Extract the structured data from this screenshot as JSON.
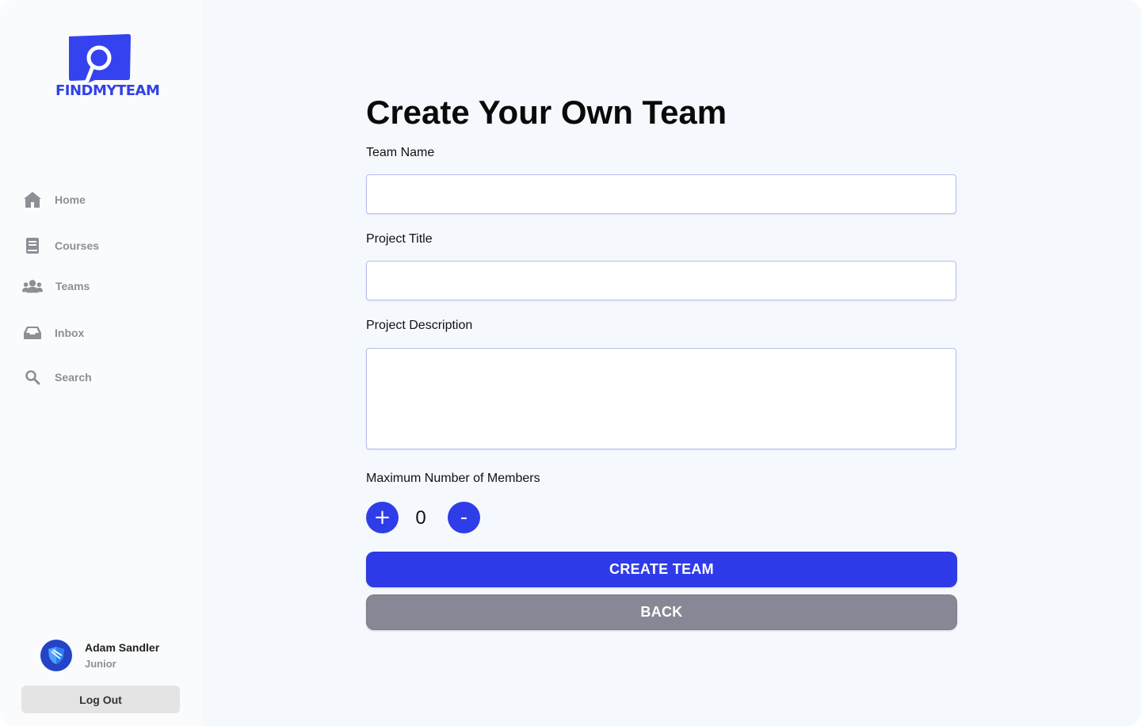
{
  "brand": {
    "name": "FINDMYTEAM",
    "color": "#3240e6"
  },
  "sidebar": {
    "items": [
      {
        "label": "Home",
        "icon": "home-icon"
      },
      {
        "label": "Courses",
        "icon": "book-icon"
      },
      {
        "label": "Teams",
        "icon": "users-icon"
      },
      {
        "label": "Inbox",
        "icon": "inbox-icon"
      },
      {
        "label": "Search",
        "icon": "search-icon"
      }
    ],
    "user": {
      "name": "Adam Sandler",
      "year": "Junior",
      "avatar_icon": "shield-avatar-icon"
    },
    "logout_label": "Log Out"
  },
  "form": {
    "title": "Create Your Own Team",
    "team_name": {
      "label": "Team Name",
      "value": "",
      "placeholder": ""
    },
    "project_title": {
      "label": "Project Title",
      "value": "",
      "placeholder": ""
    },
    "project_description": {
      "label": "Project Description",
      "value": "",
      "placeholder": ""
    },
    "max_members": {
      "label": "Maximum Number of Members",
      "value": "0",
      "increment": "+",
      "decrement": "-"
    },
    "create_label": "CREATE TEAM",
    "back_label": "BACK"
  },
  "colors": {
    "accent": "#2f3be9",
    "back_button": "#868896",
    "background": "#f5f9fd"
  }
}
